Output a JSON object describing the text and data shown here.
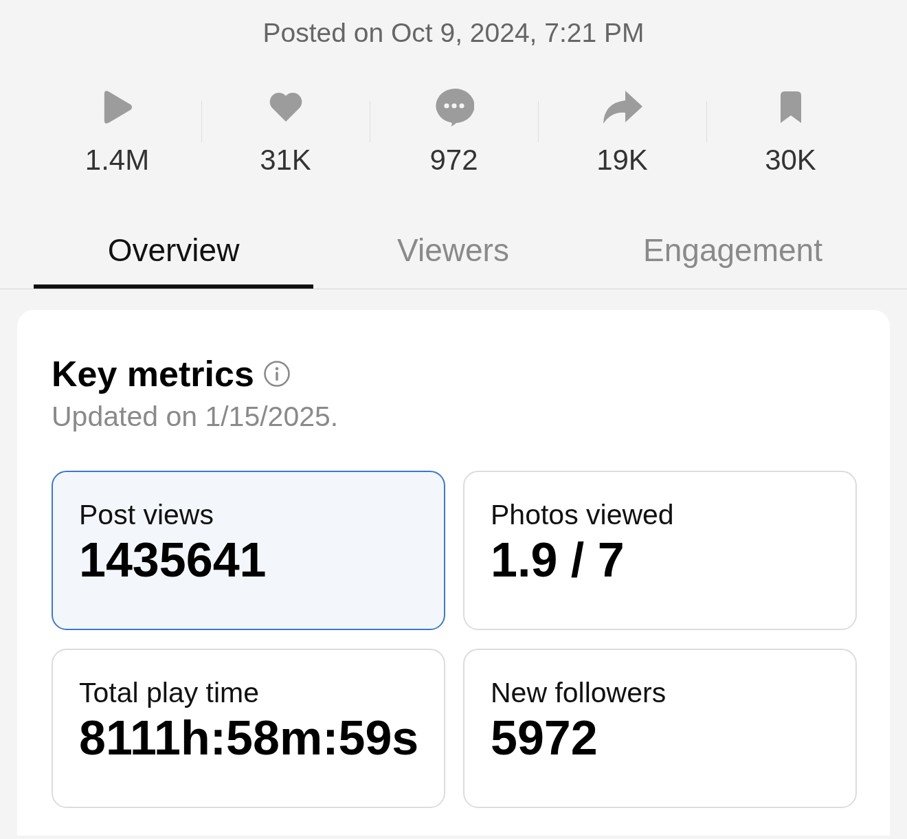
{
  "posted": "Posted on Oct 9, 2024, 7:21 PM",
  "stats": [
    {
      "kind": "play",
      "value": "1.4M"
    },
    {
      "kind": "like",
      "value": "31K"
    },
    {
      "kind": "comment",
      "value": "972"
    },
    {
      "kind": "share",
      "value": "19K"
    },
    {
      "kind": "save",
      "value": "30K"
    }
  ],
  "tabs": [
    {
      "label": "Overview",
      "selected": true
    },
    {
      "label": "Viewers",
      "selected": false
    },
    {
      "label": "Engagement",
      "selected": false
    }
  ],
  "key_metrics": {
    "title": "Key metrics",
    "updated": "Updated on 1/15/2025.",
    "metrics": [
      {
        "label": "Post views",
        "value": "1435641",
        "selected": true
      },
      {
        "label": "Photos viewed",
        "value": "1.9 / 7",
        "selected": false
      },
      {
        "label": "Total play time",
        "value": "8111h:58m:59s",
        "selected": false
      },
      {
        "label": "New followers",
        "value": "5972",
        "selected": false
      }
    ]
  }
}
